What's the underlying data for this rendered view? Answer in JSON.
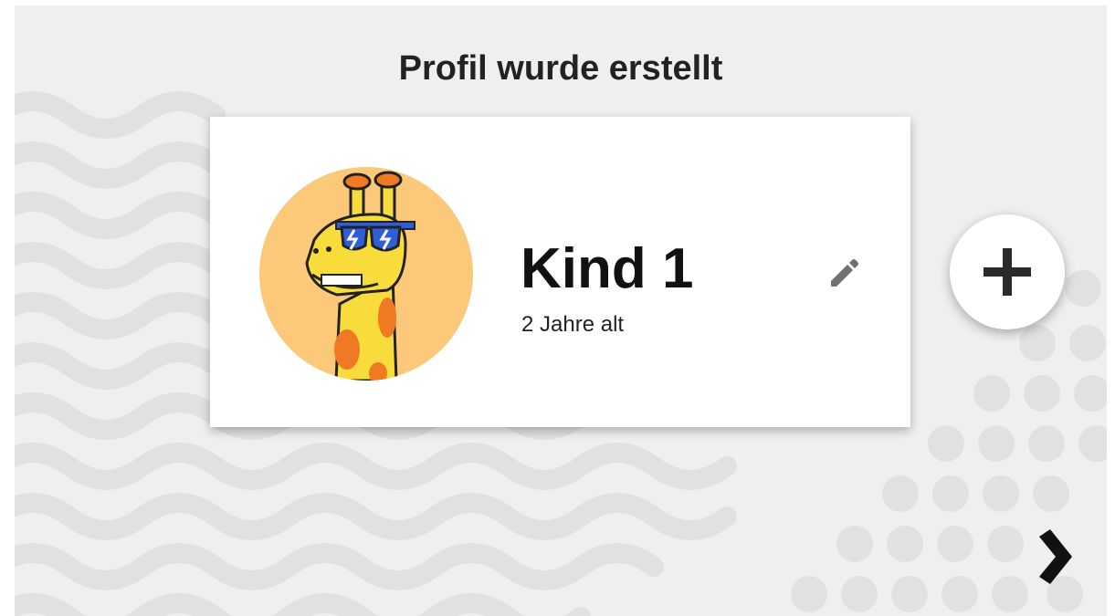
{
  "header": {
    "title": "Profil wurde erstellt"
  },
  "profile": {
    "name": "Kind 1",
    "age": "2 Jahre alt",
    "avatar": "giraffe-with-sunglasses"
  },
  "actions": {
    "edit_icon": "pencil-icon",
    "add_icon": "plus-icon",
    "next_icon": "chevron-right-icon"
  },
  "colors": {
    "background": "#efefef",
    "card": "#ffffff",
    "avatar_bg": "#fcc87a",
    "giraffe_yellow": "#f7dc3b",
    "giraffe_spots": "#f07a23",
    "sunglasses": "#2e5fd9",
    "icon_dark": "#222222"
  }
}
